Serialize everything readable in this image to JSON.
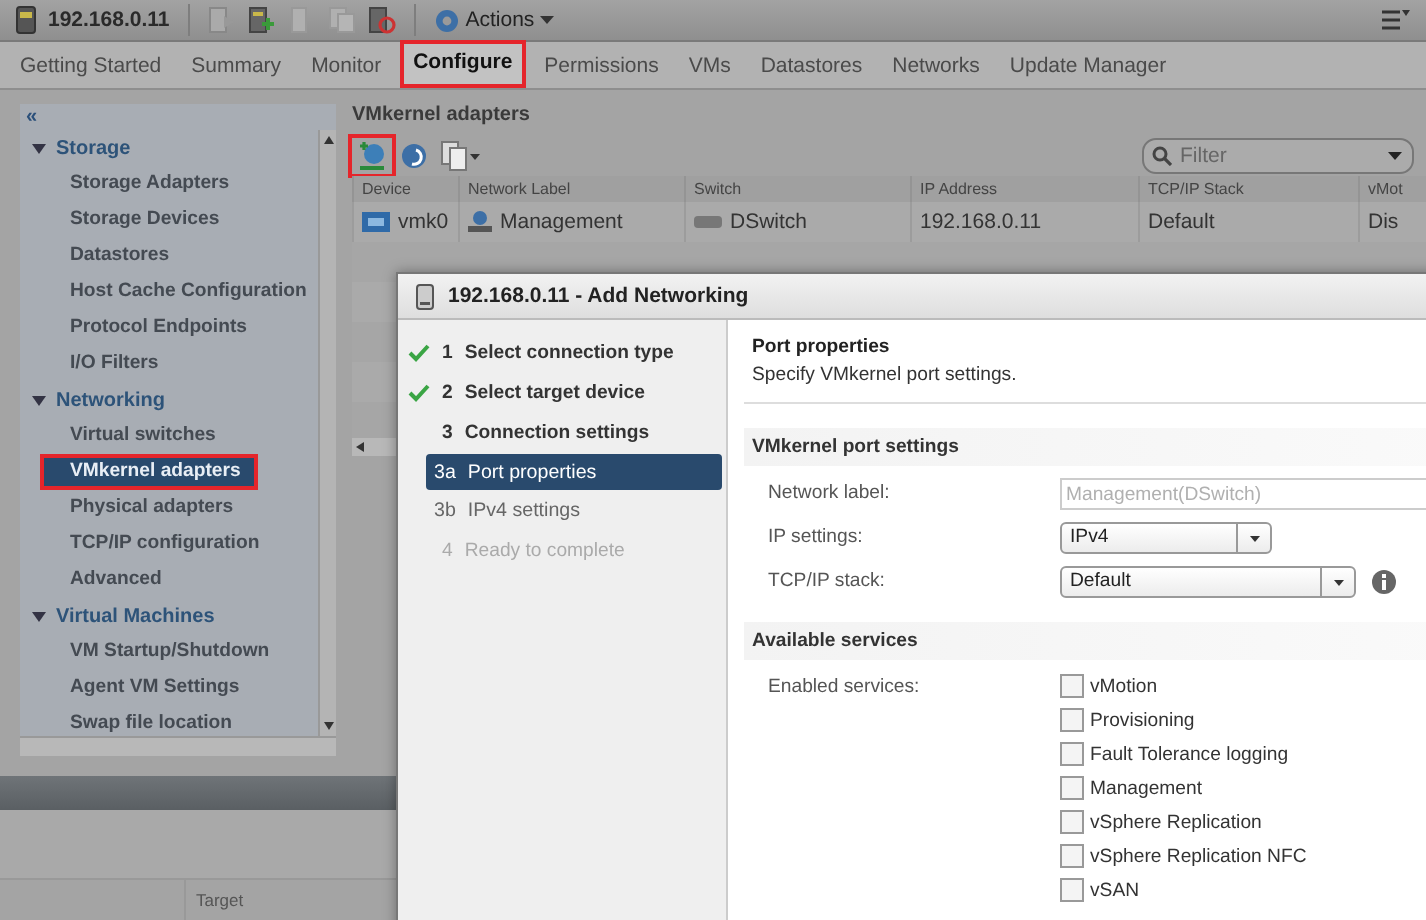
{
  "toolbar": {
    "host": "192.168.0.11",
    "actions": "Actions"
  },
  "tabs": [
    {
      "label": "Getting Started",
      "selected": false,
      "highlighted": false
    },
    {
      "label": "Summary",
      "selected": false,
      "highlighted": false
    },
    {
      "label": "Monitor",
      "selected": false,
      "highlighted": false
    },
    {
      "label": "Configure",
      "selected": true,
      "highlighted": true
    },
    {
      "label": "Permissions",
      "selected": false,
      "highlighted": false
    },
    {
      "label": "VMs",
      "selected": false,
      "highlighted": false
    },
    {
      "label": "Datastores",
      "selected": false,
      "highlighted": false
    },
    {
      "label": "Networks",
      "selected": false,
      "highlighted": false
    },
    {
      "label": "Update Manager",
      "selected": false,
      "highlighted": false
    }
  ],
  "sidebar": {
    "collapse": "«",
    "groups": [
      {
        "label": "Storage",
        "expanded": true,
        "items": [
          {
            "label": "Storage Adapters",
            "selected": false,
            "highlighted": false
          },
          {
            "label": "Storage Devices",
            "selected": false,
            "highlighted": false
          },
          {
            "label": "Datastores",
            "selected": false,
            "highlighted": false
          },
          {
            "label": "Host Cache Configuration",
            "selected": false,
            "highlighted": false
          },
          {
            "label": "Protocol Endpoints",
            "selected": false,
            "highlighted": false
          },
          {
            "label": "I/O Filters",
            "selected": false,
            "highlighted": false
          }
        ]
      },
      {
        "label": "Networking",
        "expanded": true,
        "items": [
          {
            "label": "Virtual switches",
            "selected": false,
            "highlighted": false
          },
          {
            "label": "VMkernel adapters",
            "selected": true,
            "highlighted": true
          },
          {
            "label": "Physical adapters",
            "selected": false,
            "highlighted": false
          },
          {
            "label": "TCP/IP configuration",
            "selected": false,
            "highlighted": false
          },
          {
            "label": "Advanced",
            "selected": false,
            "highlighted": false
          }
        ]
      },
      {
        "label": "Virtual Machines",
        "expanded": true,
        "items": [
          {
            "label": "VM Startup/Shutdown",
            "selected": false,
            "highlighted": false
          },
          {
            "label": "Agent VM Settings",
            "selected": false,
            "highlighted": false
          },
          {
            "label": "Swap file location",
            "selected": false,
            "highlighted": false
          }
        ]
      }
    ]
  },
  "adapters": {
    "title": "VMkernel adapters",
    "add_highlighted": true,
    "filter_placeholder": "Filter",
    "columns": [
      "Device",
      "Network Label",
      "Switch",
      "IP Address",
      "TCP/IP Stack",
      "vMot"
    ],
    "rows": [
      {
        "cells": [
          "vmk0",
          "Management",
          "DSwitch",
          "192.168.0.11",
          "Default",
          "Dis"
        ]
      }
    ]
  },
  "bottom_table": {
    "columns": [
      "Target"
    ]
  },
  "dialog": {
    "title": "192.168.0.11 - Add Networking",
    "steps": [
      {
        "number": "1",
        "label": "Select connection type",
        "done": true,
        "selected": false,
        "disabled": false
      },
      {
        "number": "2",
        "label": "Select target device",
        "done": true,
        "selected": false,
        "disabled": false
      },
      {
        "number": "3",
        "label": "Connection settings",
        "done": false,
        "selected": false,
        "disabled": false,
        "children": [
          {
            "number": "3a",
            "label": "Port properties",
            "selected": true,
            "disabled": false
          },
          {
            "number": "3b",
            "label": "IPv4 settings",
            "selected": false,
            "disabled": false
          }
        ]
      },
      {
        "number": "4",
        "label": "Ready to complete",
        "done": false,
        "selected": false,
        "disabled": true
      }
    ],
    "page_title": "Port properties",
    "page_subtitle": "Specify VMkernel port settings.",
    "sections": [
      {
        "kind": "fields",
        "title": "VMkernel port settings",
        "fields": [
          {
            "kind": "text",
            "label": "Network label:",
            "value": "Management(DSwitch)",
            "disabled": true,
            "info": false
          },
          {
            "kind": "select",
            "label": "IP settings:",
            "value": "IPv4",
            "disabled": false,
            "info": false
          },
          {
            "kind": "select",
            "label": "TCP/IP stack:",
            "value": "Default",
            "disabled": false,
            "info": true
          }
        ]
      },
      {
        "kind": "checklist",
        "title": "Available services",
        "label": "Enabled services:",
        "services": [
          {
            "label": "vMotion",
            "checked": false
          },
          {
            "label": "Provisioning",
            "checked": false
          },
          {
            "label": "Fault Tolerance logging",
            "checked": false
          },
          {
            "label": "Management",
            "checked": false
          },
          {
            "label": "vSphere Replication",
            "checked": false
          },
          {
            "label": "vSphere Replication NFC",
            "checked": false
          },
          {
            "label": "vSAN",
            "checked": false
          }
        ]
      }
    ]
  }
}
